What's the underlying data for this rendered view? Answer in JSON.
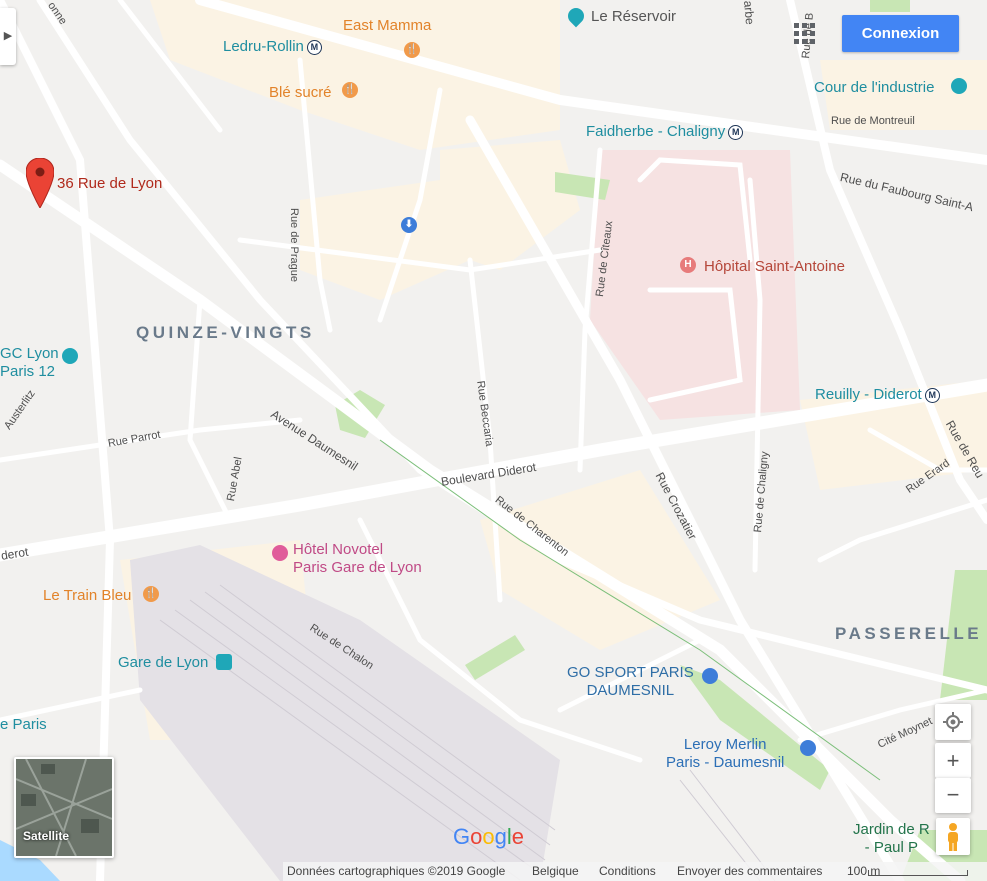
{
  "header": {
    "connexion_label": "Connexion",
    "apps_icon": "apps-grid-icon"
  },
  "neighborhoods": {
    "quinze_vingts": "QUINZE-VINGTS",
    "passerelle": "PASSERELLE"
  },
  "marker": {
    "label": "36 Rue de Lyon",
    "color": "#ea4335"
  },
  "pois": {
    "east_mamma": "East Mamma",
    "ble_sucre": "Blé sucré",
    "le_reservoir": "Le Réservoir",
    "cour_industrie": "Cour de l'industrie",
    "hopital": "Hôpital Saint-Antoine",
    "ugc_line1": "GC Lyon",
    "ugc_line2": "Paris 12",
    "novotel_line1": "Hôtel Novotel",
    "novotel_line2": "Paris Gare de Lyon",
    "train_bleu": "Le Train Bleu",
    "gare_de_lyon": "Gare de Lyon",
    "gosport_line1": "GO SPORT PARIS",
    "gosport_line2": "DAUMESNIL",
    "leroy_line1": "Leroy Merlin",
    "leroy_line2": "Paris - Daumesnil",
    "jardin_line1": "Jardin de R",
    "jardin_line2": "- Paul P",
    "de_paris": "e Paris"
  },
  "metro_stations": {
    "ledru_rollin": "Ledru-Rollin",
    "faidherbe": "Faidherbe - Chaligny",
    "reuilly": "Reuilly - Diderot",
    "metro_glyph": "M"
  },
  "streets": {
    "rue_de_montreuil": "Rue de Montreuil",
    "faubourg": "Rue du Faubourg Saint-A",
    "rue_de_prague": "Rue de Prague",
    "rue_de_citeaux": "Rue de Cîteaux",
    "avenue_daumesnil": "Avenue Daumesnil",
    "boulevard_diderot": "Boulevard Diderot",
    "diderot_left": "derot",
    "rue_parrot": "Rue Parrot",
    "rue_abel": "Rue Abel",
    "rue_beccaria": "Rue Beccaria",
    "rue_de_charenton": "Rue de Charenton",
    "rue_crozatier": "Rue Crozatier",
    "rue_de_chaligny": "Rue de Chaligny",
    "rue_erard": "Rue Erard",
    "rue_de_reuilly": "Rue de Reu",
    "rue_de_chalon": "Rue de Chalon",
    "cite_moynet": "Cité Moynet",
    "austerlitz": "Austerlitz",
    "top_left_fragment": "onne",
    "top_right_fragment": "arbe",
    "rue_de_b": "Rue de B"
  },
  "controls": {
    "satellite_label": "Satellite",
    "zoom_in": "+",
    "zoom_out": "−",
    "google_logo": "Google"
  },
  "footer": {
    "map_data": "Données cartographiques ©2019 Google",
    "country": "Belgique",
    "conditions": "Conditions",
    "feedback": "Envoyer des commentaires",
    "scale": "100 m"
  },
  "colors": {
    "water": "#aadaff",
    "park": "#c8e6b4",
    "hospital": "#f6e2e2",
    "railway": "#e4e1e6",
    "road": "#ffffff",
    "block": "#fbf3e4",
    "button_blue": "#4285f4"
  }
}
